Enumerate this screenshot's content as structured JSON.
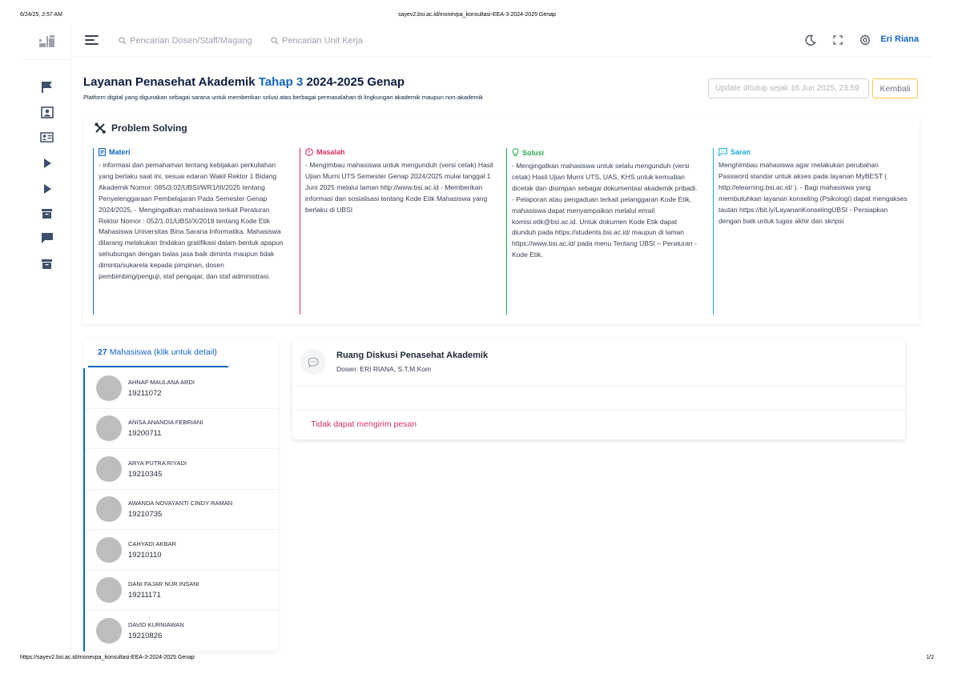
{
  "print": {
    "timestamp": "6/24/25, 2:57 AM",
    "title": "sayev2.bsi.ac.id/monevpa_konsultasi-EEA-3-2024-2025 Genap",
    "url": "https://sayev2.bsi.ac.id/monevpa_konsultasi-EEA-3-2024-2025 Genap",
    "page": "1/2"
  },
  "topbar": {
    "search_dosen_placeholder": "Pencarian Dosen/Staff/Magang",
    "search_unit_placeholder": "Pencarian Unit Kerja",
    "user_name": "Eri Riana"
  },
  "header": {
    "title_prefix": "Layanan Penasehat Akademik ",
    "title_accent": "Tahap 3",
    "title_suffix": " 2024-2025 Genap",
    "subtitle": "Platform digital yang digunakan sebagai sarana untuk memberikan solusi atas berbagai permasalahan di lingkungan akademik maupun non-akademik",
    "update_placeholder": "Update ditutup sejak 16 Jun 2025, 23:59",
    "back_label": "Kembali"
  },
  "problem_solving": {
    "title": "Problem Solving",
    "materi": {
      "label": "Materi",
      "text": "- informasi dan pemahaman tentang kebijakan perkuliahan yang berlaku saat ini, sesuai edaran Wakil Rektor 1 Bidang Akademik Nomor: 085/3.02/UBSI/WR1/III/2025 tentang Penyelenggaraan Pembelajaran Pada Semester Genap 2024/2025. - Mengingatkan mahasiswa terkait Peraturan Rektor Nomor : 052/1.01/UBSI/X/2018 tentang Kode Etik Mahasiswa Universitas Bina Sarana Informatika. Mahasiswa dilarang melakukan tindakan gratifikasi dalam bentuk apapun sehubungan dengan balas jasa baik diminta maupun tidak diminta/sukarela kepada pimpinan, dosen pembimbing/penguji, staf pengajar, dan staf administrasi."
    },
    "masalah": {
      "label": "Masalah",
      "text": "- Mengimbau mahasiswa untuk mengunduh (versi cetak) Hasil Ujian Murni UTS Semester Genap 2024/2025 mulai tanggal 1 Juni 2025 melalui laman http://www.bsi.ac.id - Memberikan informasi dan sosialisasi tentang Kode Etik Mahasiswa yang berlaku di UBSI"
    },
    "solusi": {
      "label": "Solusi",
      "text": "- Mengingatkan mahasiswa untuk selalu mengunduh (versi cetak) Hasil Ujian Murni UTS, UAS, KHS untuk kemudian dicetak dan disimpan sebagai dokumentasi akademik pribadi. - Pelaporan atau pengaduan terkait pelanggaran Kode Etik, mahasiswa dapat menyampaikan melalui email komisi.etik@bsi.ac.id. Untuk dokumen Kode Etik dapat diunduh pada https://students.bsi.ac.id/ maupun di laman https://www.bsi.ac.id/ pada menu Tentang UBSI – Peraturan - Kode Etik."
    },
    "saran": {
      "label": "Saran",
      "text": "Menghimbau mahasiswa agar melakukan perubahan Password standar untuk akses pada layanan MyBEST ( http://elearning.bsi.ac.id/ ). - Bagi mahasiswa yang membutuhkan layanan konseling (Psikologi) dapat mengakses tautan https://bit.ly/LayananKonselingUBSI - Persiapkan dengan baik untuk tugas akhir dan skripsi"
    }
  },
  "students": {
    "count": "27",
    "tab_label": "Mahasiswa (klik untuk detail)",
    "items": [
      {
        "name": "AHNAF MAULANA ARDI",
        "nim": "19211072"
      },
      {
        "name": "ANISA ANANDIA FEBRIANI",
        "nim": "19200711"
      },
      {
        "name": "ARYA PUTRA RIYADI",
        "nim": "19210345"
      },
      {
        "name": "AWANDA NOVAYANTI CINDY RAMAN",
        "nim": "19210735"
      },
      {
        "name": "CAHYADI AKBAR",
        "nim": "19210110"
      },
      {
        "name": "DANI FAJAR NUR INSANI",
        "nim": "19211171"
      },
      {
        "name": "DAVID KURNIAWAN",
        "nim": "19210826"
      }
    ]
  },
  "discussion": {
    "title": "Ruang Diskusi Penasehat Akademik",
    "lecturer": "Dosen: ERI RIANA, S.T,M.Kom",
    "error": "Tidak dapat mengirim pesan"
  },
  "colors": {
    "primary": "#1565c0",
    "danger": "#d6335e",
    "success": "#2aa44f",
    "info": "#1ba8d6",
    "warning": "#f5c842"
  }
}
